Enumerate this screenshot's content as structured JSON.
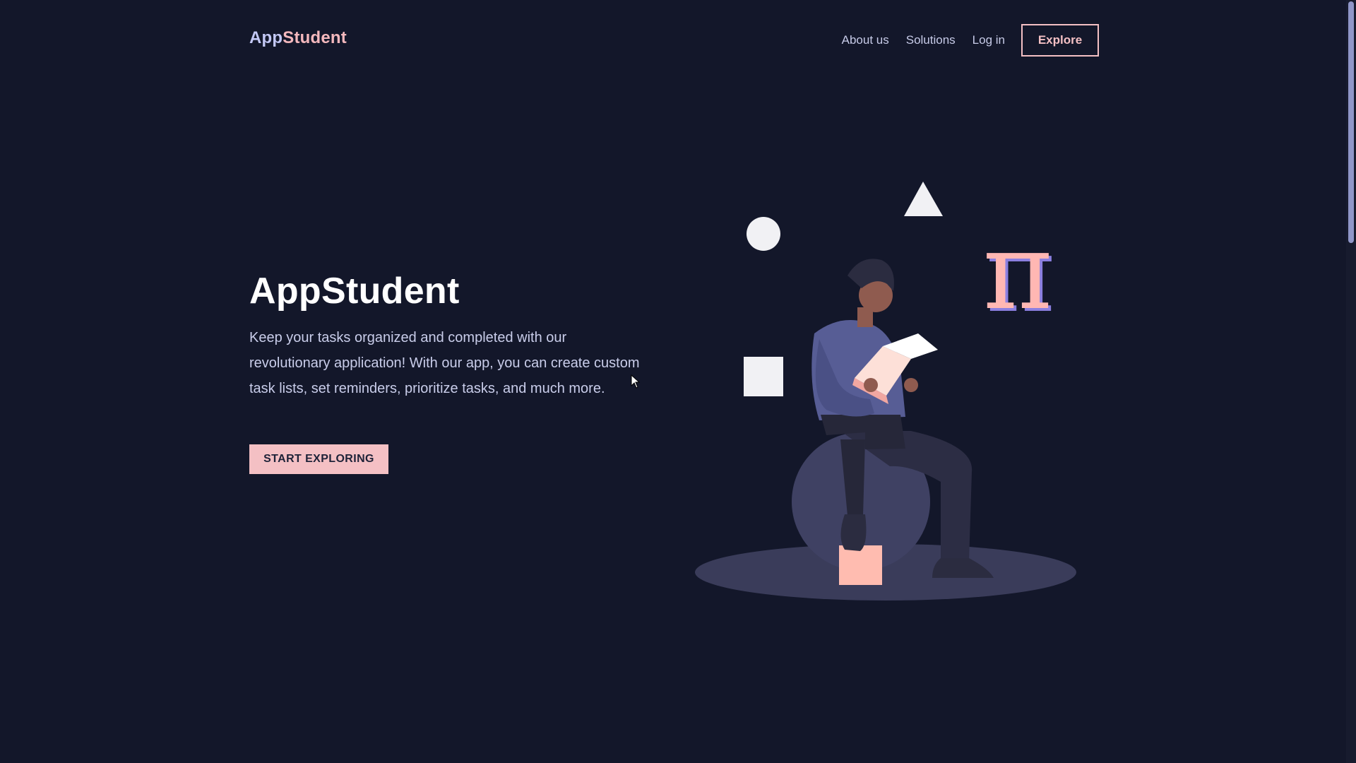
{
  "header": {
    "logo_part_a": "App",
    "logo_part_b": "Student",
    "nav": {
      "about": "About us",
      "solutions": "Solutions",
      "login": "Log in",
      "explore": "Explore"
    }
  },
  "hero": {
    "title": "AppStudent",
    "description": "Keep your tasks organized and completed with our revolutionary application! With our app, you can create custom task lists, set reminders, prioritize tasks, and much more.",
    "cta": "START EXPLORING"
  },
  "illustration": {
    "pi_symbol": "π"
  },
  "colors": {
    "background": "#13172a",
    "accent_pink": "#f4c0c4",
    "logo_lavender": "#c3c8f5",
    "text_muted": "#c9cdea"
  }
}
